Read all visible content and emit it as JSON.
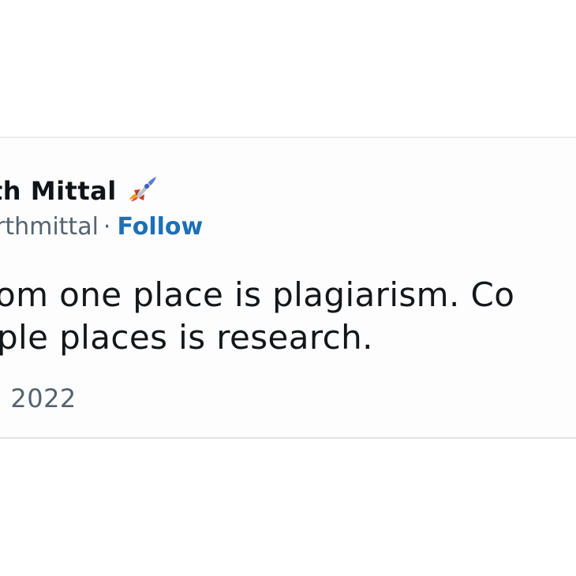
{
  "tweet": {
    "author_name": "th Mittal",
    "author_icon": "rocket-icon",
    "handle": "rthmittal",
    "separator": "·",
    "follow_label": "Follow",
    "text_line_1": "om one place is plagiarism. Co",
    "text_line_2": "ple places is research.",
    "timestamp": ", 2022"
  },
  "colors": {
    "follow": "#1d6fb8",
    "secondary_text": "#536471",
    "primary_text": "#0f1419",
    "card_background": "#fdfdfd",
    "card_border": "#ececec"
  }
}
